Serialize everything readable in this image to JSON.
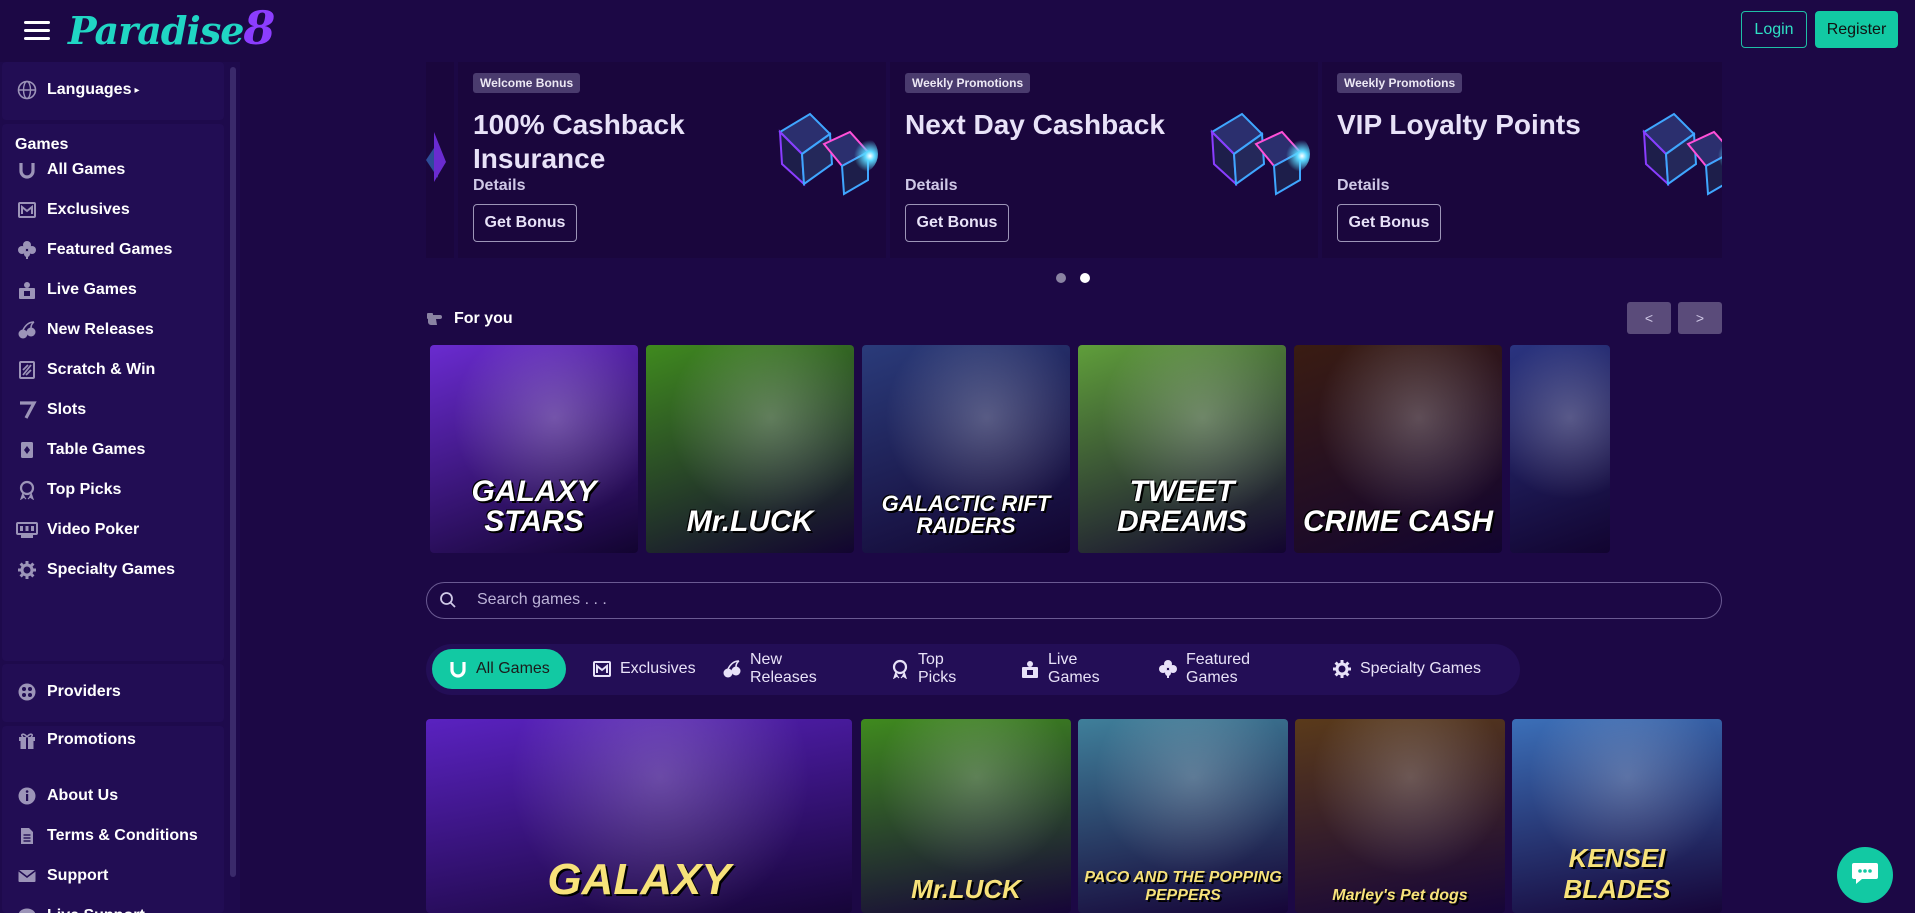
{
  "header": {
    "logo_word": "Paradise",
    "logo_num": "8",
    "login": "Login",
    "register": "Register"
  },
  "sidebar": {
    "languages": "Languages",
    "games_heading": "Games",
    "games": [
      {
        "label": "All Games",
        "icon": "horseshoe-icon"
      },
      {
        "label": "Exclusives",
        "icon": "exclusives-icon"
      },
      {
        "label": "Featured Games",
        "icon": "clover-icon"
      },
      {
        "label": "Live Games",
        "icon": "live-dealer-icon"
      },
      {
        "label": "New Releases",
        "icon": "cherries-icon"
      },
      {
        "label": "Scratch & Win",
        "icon": "scratch-card-icon"
      },
      {
        "label": "Slots",
        "icon": "seven-icon"
      },
      {
        "label": "Table Games",
        "icon": "cards-icon"
      },
      {
        "label": "Top Picks",
        "icon": "award-icon"
      },
      {
        "label": "Video Poker",
        "icon": "poker-machine-icon"
      },
      {
        "label": "Specialty Games",
        "icon": "gear-icon"
      }
    ],
    "providers": "Providers",
    "promotions": "Promotions",
    "info": [
      {
        "label": "About Us",
        "icon": "info-icon"
      },
      {
        "label": "Terms & Conditions",
        "icon": "document-icon"
      },
      {
        "label": "Support",
        "icon": "mail-icon"
      },
      {
        "label": "Live Support",
        "icon": "chat-icon"
      }
    ]
  },
  "promos": [
    {
      "badge": "Welcome Bonus",
      "title": "100% Cashback Insurance",
      "details": "Details",
      "button": "Get Bonus"
    },
    {
      "badge": "Weekly Promotions",
      "title": "Next Day Cashback",
      "details": "Details",
      "button": "Get Bonus"
    },
    {
      "badge": "Weekly Promotions",
      "title": "VIP Loyalty Points",
      "details": "Details",
      "button": "Get Bonus"
    }
  ],
  "carousel_dots": {
    "count": 2,
    "active": 2
  },
  "for_you": {
    "title": "For you",
    "prev": "<",
    "next": ">",
    "games": [
      {
        "name": "GALAXY STARS",
        "bg": "#6a2bd0"
      },
      {
        "name": "Mr.LUCK",
        "bg": "#3f8a1e"
      },
      {
        "name": "GALACTIC RIFT RAIDERS",
        "bg": "#2a3b7a"
      },
      {
        "name": "TWEET DREAMS",
        "bg": "#5f9e3a"
      },
      {
        "name": "CRIME CASH",
        "bg": "#3a1c12"
      },
      {
        "name": "",
        "bg": "#2a3480"
      }
    ]
  },
  "search": {
    "placeholder": "Search games . . ."
  },
  "tabs": [
    {
      "label": "All Games",
      "icon": "horseshoe-icon",
      "active": true
    },
    {
      "label": "Exclusives",
      "icon": "exclusives-icon",
      "active": false
    },
    {
      "label": "New Releases",
      "icon": "cherries-icon",
      "active": false
    },
    {
      "label": "Top Picks",
      "icon": "award-icon",
      "active": false
    },
    {
      "label": "Live Games",
      "icon": "live-dealer-icon",
      "active": false
    },
    {
      "label": "Featured Games",
      "icon": "clover-icon",
      "active": false
    },
    {
      "label": "Specialty Games",
      "icon": "gear-icon",
      "active": false
    }
  ],
  "grid": [
    {
      "name": "GALAXY",
      "bg": "#5a22c0"
    },
    {
      "name": "Mr.LUCK",
      "bg": "#3f8a1e"
    },
    {
      "name": "PACO AND THE POPPING PEPPERS",
      "bg": "#3f7f9a"
    },
    {
      "name": "Marley's Pet dogs",
      "bg": "#5a3a1a"
    },
    {
      "name": "KENSEI BLADES",
      "bg": "#3b6fb8"
    }
  ],
  "colors": {
    "accent": "#12c9a3",
    "bg": "#1c0845",
    "sidebar": "#1e0a4c"
  }
}
